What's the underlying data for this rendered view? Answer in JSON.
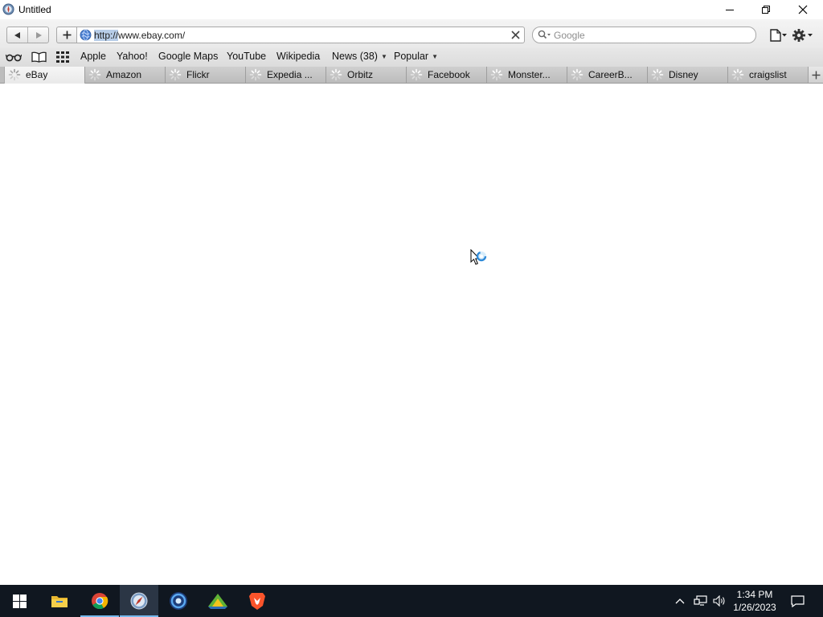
{
  "window": {
    "title": "Untitled",
    "controls": {
      "minimize": "minimize",
      "restore": "restore",
      "close": "close"
    }
  },
  "toolbar": {
    "address": {
      "url_selected": "http://",
      "url_rest": "www.ebay.com/"
    },
    "search": {
      "placeholder": "Google"
    }
  },
  "bookmarks": {
    "items": [
      "Apple",
      "Yahoo!",
      "Google Maps",
      "YouTube",
      "Wikipedia"
    ],
    "news": "News (38)",
    "popular": "Popular"
  },
  "tabs": [
    {
      "label": "eBay",
      "active": true
    },
    {
      "label": "Amazon"
    },
    {
      "label": "Flickr"
    },
    {
      "label": "Expedia ..."
    },
    {
      "label": "Orbitz"
    },
    {
      "label": "Facebook"
    },
    {
      "label": "Monster..."
    },
    {
      "label": "CareerB..."
    },
    {
      "label": "Disney"
    },
    {
      "label": "craigslist"
    }
  ],
  "taskbar": {
    "apps": [
      "start",
      "file-explorer",
      "chrome",
      "safari",
      "app-blue",
      "app-green",
      "brave"
    ],
    "clock": {
      "time": "1:34 PM",
      "date": "1/26/2023"
    }
  },
  "colors": {
    "taskbar": "#101720",
    "selection": "#b7cde8",
    "accent": "#76b9ed"
  }
}
